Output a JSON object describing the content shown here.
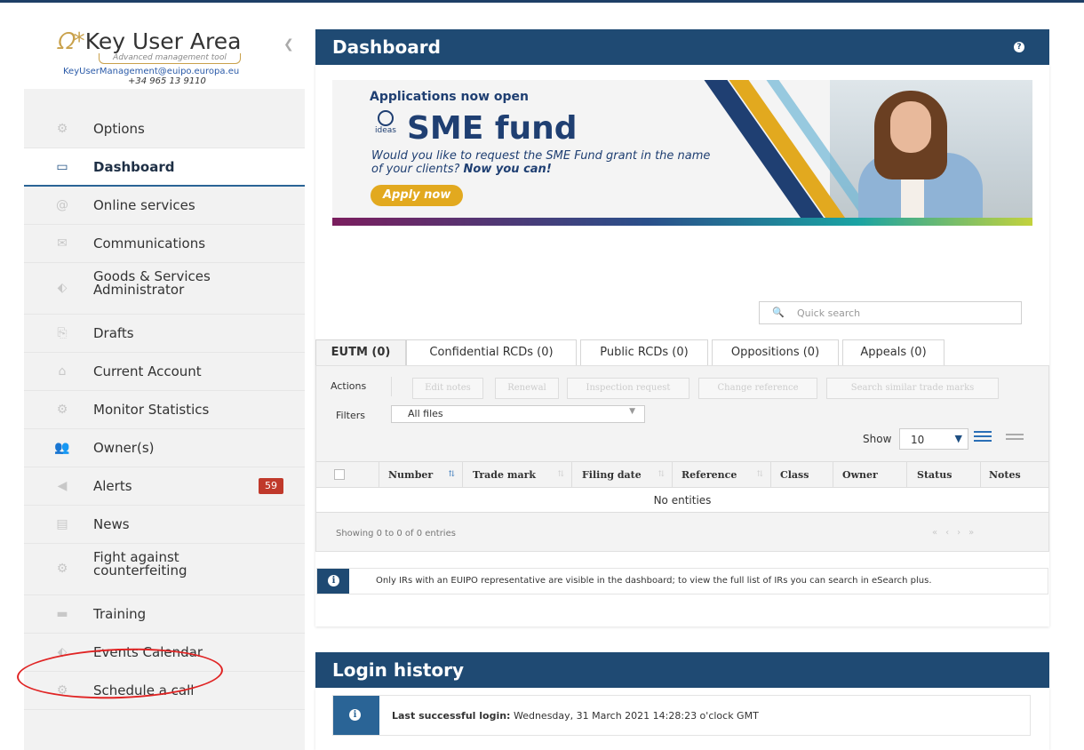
{
  "brand": {
    "title": "Key User Area",
    "subtitle": "Advanced management tool",
    "email": "KeyUserManagement@euipo.europa.eu",
    "phone": "+34 965 13 9110"
  },
  "sidebar": {
    "items": [
      {
        "label": "Options",
        "icon": "gear-icon"
      },
      {
        "label": "Dashboard",
        "icon": "dashboard-icon",
        "active": true
      },
      {
        "label": "Online services",
        "icon": "at-icon"
      },
      {
        "label": "Communications",
        "icon": "envelope-icon"
      },
      {
        "label": "Goods & Services Administrator",
        "icon": "tags-icon"
      },
      {
        "label": "Drafts",
        "icon": "drafts-icon"
      },
      {
        "label": "Current Account",
        "icon": "bank-icon"
      },
      {
        "label": "Monitor Statistics",
        "icon": "gear-icon"
      },
      {
        "label": "Owner(s)",
        "icon": "users-icon"
      },
      {
        "label": "Alerts",
        "icon": "bullhorn-icon",
        "badge": "59"
      },
      {
        "label": "News",
        "icon": "book-icon"
      },
      {
        "label": "Fight against counterfeiting",
        "icon": "gear-icon"
      },
      {
        "label": "Training",
        "icon": "monitor-icon"
      },
      {
        "label": "Events Calendar",
        "icon": "tags-icon"
      },
      {
        "label": "Schedule a call",
        "icon": "gear-icon"
      }
    ],
    "annotation_color": "#e02424"
  },
  "dashboard": {
    "title": "Dashboard",
    "banner": {
      "kicker": "Applications now open",
      "logo_text": "ideas",
      "headline": "SME fund",
      "question": "Would you like to request the SME Fund grant in the name of your clients?",
      "question_emphasis": "Now you can!",
      "cta": "Apply now"
    },
    "quick_search_placeholder": "Quick search",
    "tabs": [
      "EUTM (0)",
      "Confidential RCDs (0)",
      "Public RCDs (0)",
      "Oppositions (0)",
      "Appeals (0)"
    ],
    "actions_label": "Actions",
    "actions": [
      "Edit notes",
      "Renewal",
      "Inspection request",
      "Change reference",
      "Search similar trade marks"
    ],
    "filters_label": "Filters",
    "filter_value": "All files",
    "show_label": "Show",
    "show_value": "10",
    "columns": [
      "Number",
      "Trade mark",
      "Filing date",
      "Reference",
      "Class",
      "Owner",
      "Status",
      "Notes"
    ],
    "empty_text": "No entities",
    "showing_text": "Showing 0 to 0 of 0 entries",
    "info_text": "Only IRs with an EUIPO representative are visible in the dashboard; to view the full list of IRs you can search in eSearch plus."
  },
  "login_history": {
    "title": "Login history",
    "label": "Last successful login:",
    "value": "Wednesday, 31 March 2021 14:28:23 o'clock GMT"
  },
  "colors": {
    "header": "#1f4a73",
    "accent": "#e2a91f",
    "badge": "#c0392b"
  }
}
